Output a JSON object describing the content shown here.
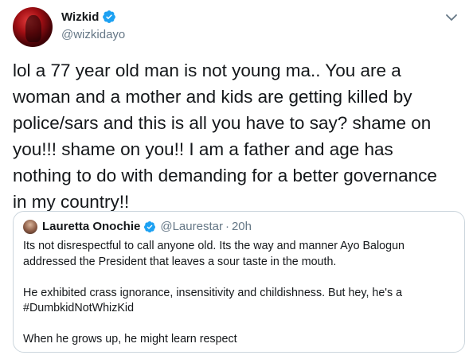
{
  "tweet": {
    "author": {
      "display_name": "Wizkid",
      "handle": "@wizkidayo",
      "verified": true
    },
    "text": "lol a 77 year old man is not young ma.. You are a\nwoman and a mother and kids are getting killed by\npolice/sars and this is all you have to say? shame on\nyou!!! shame on you!! I am a father and age has\nnothing to do with demanding for a better governance\nin my country!!",
    "quoted": {
      "author": {
        "display_name": "Lauretta Onochie",
        "handle": "@Laurestar",
        "verified": true
      },
      "separator": "·",
      "time": "20h",
      "text": "Its not disrespectful to call anyone old. Its the way and manner Ayo Balogun\naddressed the President that leaves a sour taste in the mouth.\n\nHe exhibited crass ignorance, insensitivity and childishness. But hey, he's a\n#DumbkidNotWhizKid\n\nWhen he grows up, he might learn respect"
    }
  },
  "colors": {
    "accent": "#1da1f2",
    "muted_text": "#657786",
    "border": "#ccd6dd"
  },
  "icons": {
    "verified": "verified-badge-icon",
    "more": "chevron-down-icon"
  }
}
